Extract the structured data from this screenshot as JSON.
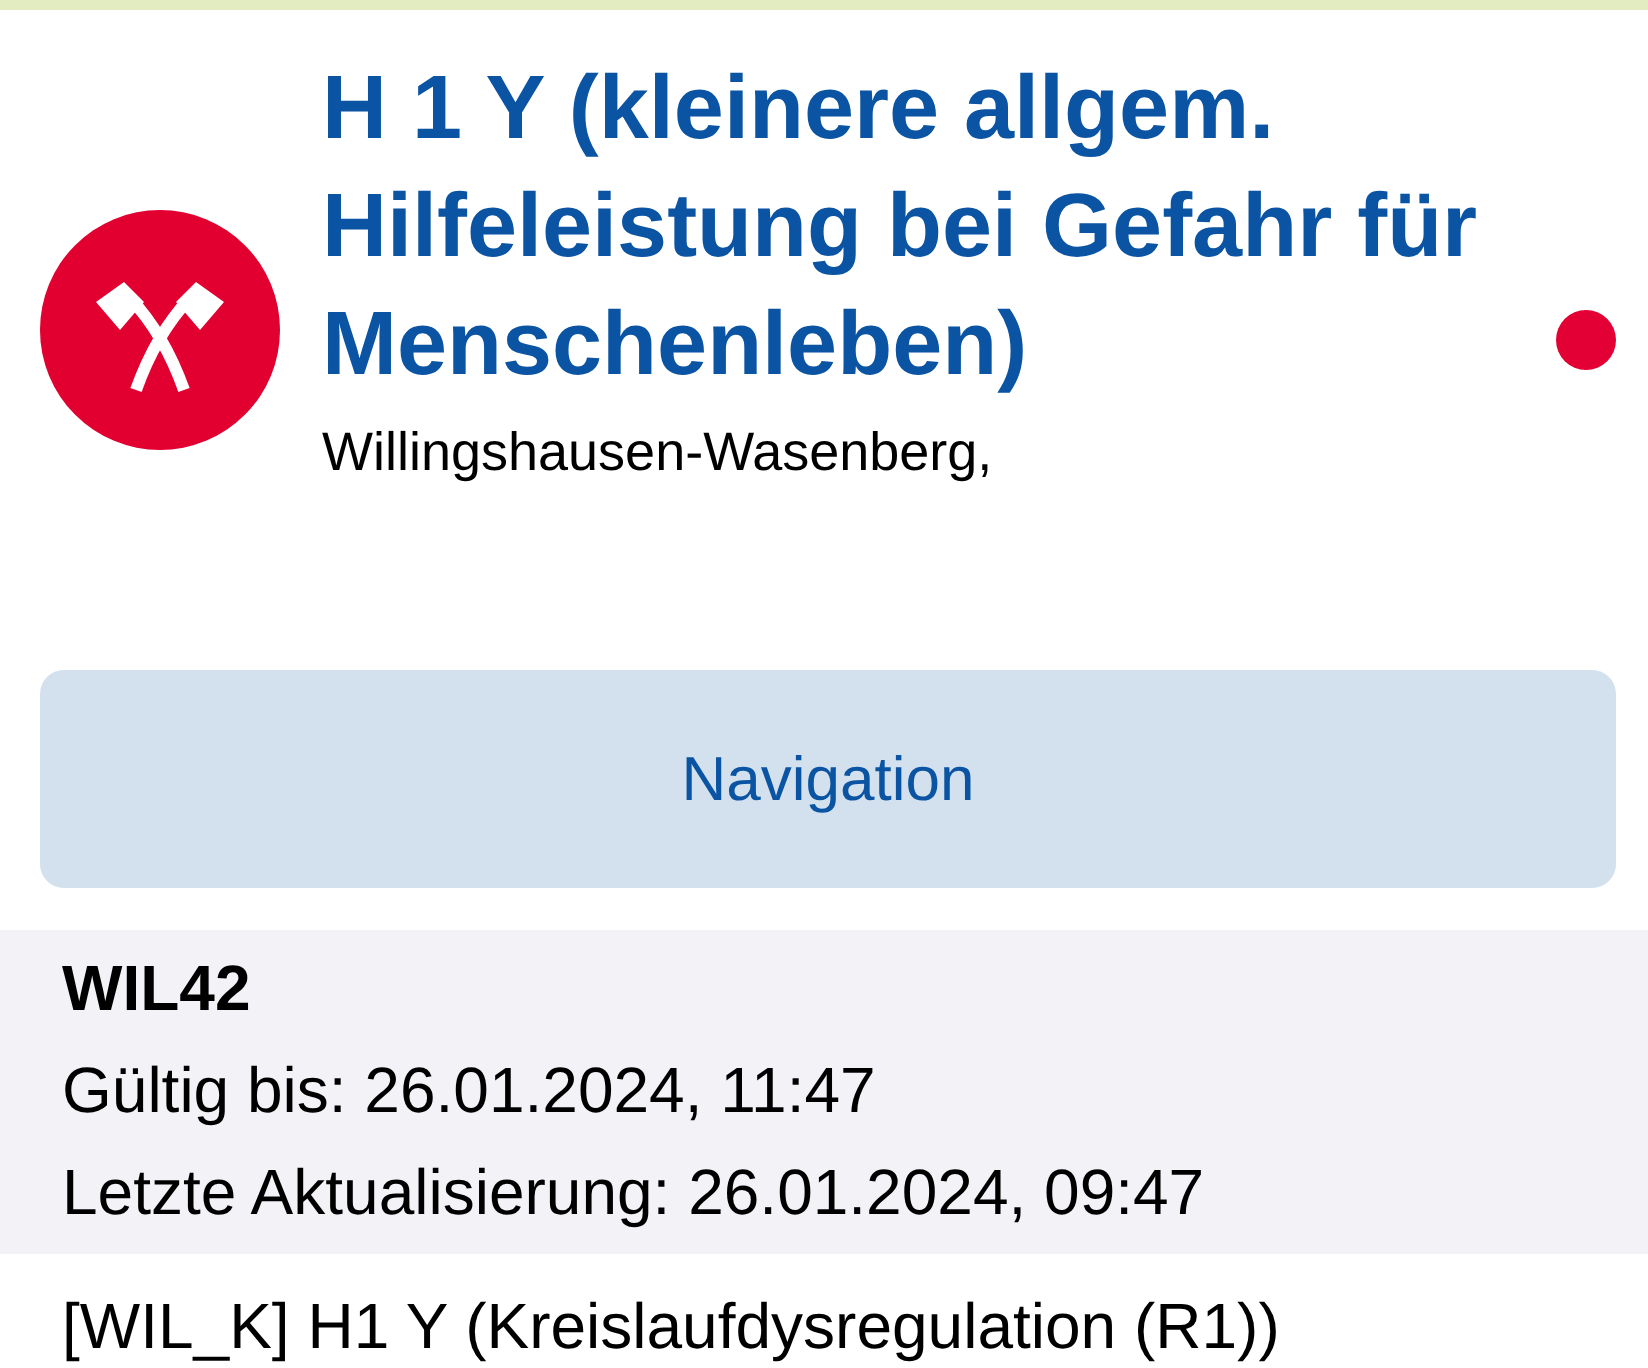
{
  "header": {
    "title": "H 1 Y (kleinere allgem. Hilfeleistung bei Gefahr für Menschenleben)",
    "location": "Willingshausen-Wasenberg,",
    "status_dot": true
  },
  "navigation_button": {
    "label": "Navigation"
  },
  "details": {
    "unit": "WIL42",
    "lines": [
      "Gültig bis: 26.01.2024, 11:47",
      "Letzte Aktualisierung: 26.01.2024, 09:47"
    ]
  },
  "messages": [
    "[WIL_K] H1 Y (Kreislaufdysregulation (R1))"
  ]
}
